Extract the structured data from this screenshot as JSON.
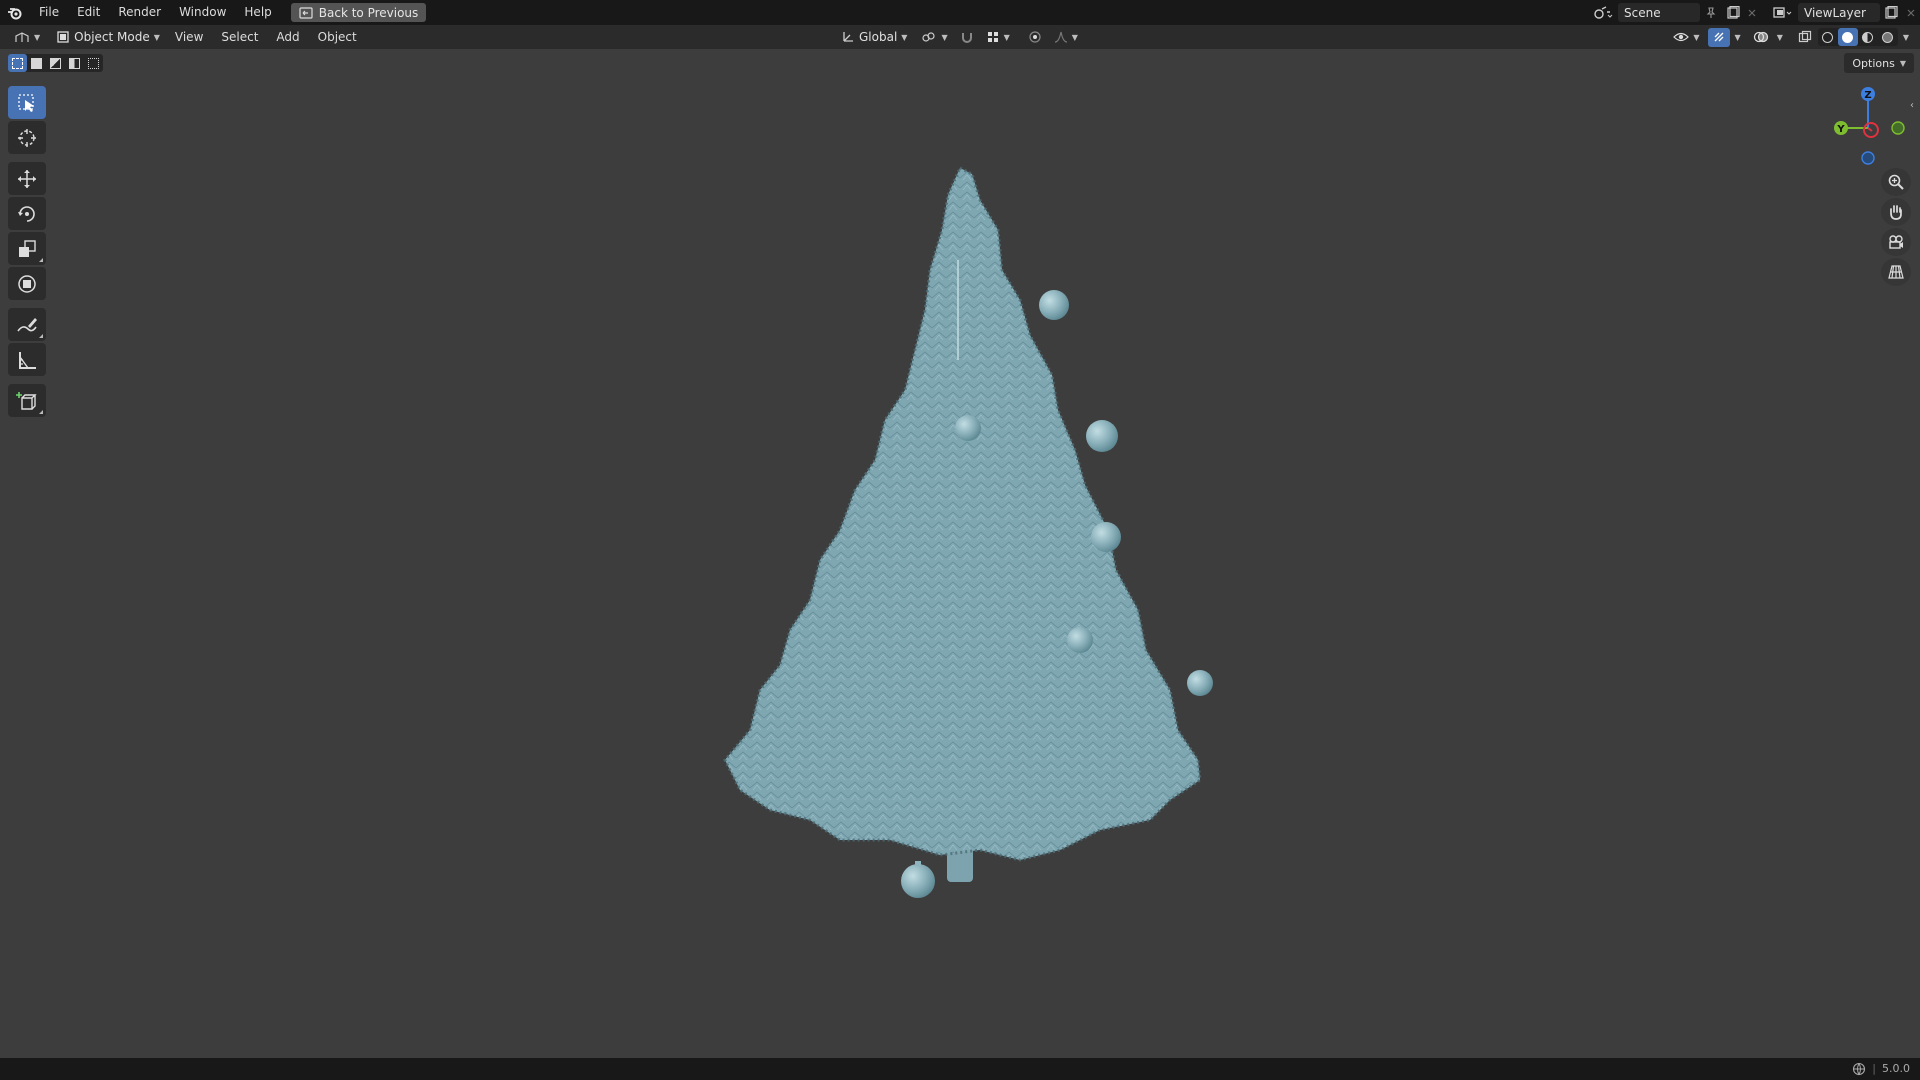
{
  "topbar": {
    "menus": [
      "File",
      "Edit",
      "Render",
      "Window",
      "Help"
    ],
    "back_button": "Back to Previous",
    "scene_name": "Scene",
    "view_layer": "ViewLayer"
  },
  "header": {
    "mode": "Object Mode",
    "menus": [
      "View",
      "Select",
      "Add",
      "Object"
    ],
    "transform_orientation": "Global"
  },
  "viewport": {
    "options_label": "Options",
    "axes": {
      "x": "X",
      "y": "Y",
      "z": "Z"
    },
    "colors": {
      "background": "#3d3d3d",
      "tree": "#7fa7b2",
      "ornament": "#8fb6c0",
      "accent": "#4772b3",
      "axis_x": "#e0323f",
      "axis_y": "#7fbd30",
      "axis_z": "#3d7fe0"
    }
  },
  "toolbar": {
    "tools": [
      "select-box",
      "cursor",
      "move",
      "rotate",
      "scale",
      "transform",
      "annotate",
      "measure",
      "add-cube"
    ],
    "active_tool": "select-box"
  },
  "statusbar": {
    "version": "5.0.0"
  }
}
